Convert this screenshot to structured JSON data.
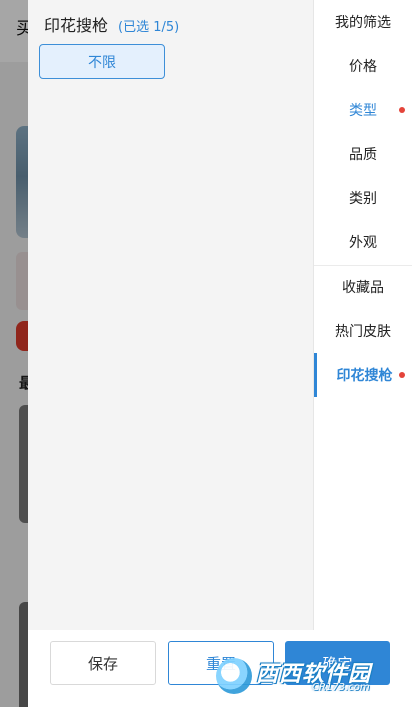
{
  "background": {
    "header_text": "买",
    "section_char": "最"
  },
  "filter": {
    "section_title": "印花搜枪",
    "selected_count": "(已选 1/5)",
    "option_unlimited": "不限"
  },
  "nav": {
    "items": [
      {
        "label": "我的筛选"
      },
      {
        "label": "价格"
      },
      {
        "label": "类型"
      },
      {
        "label": "品质"
      },
      {
        "label": "类别"
      },
      {
        "label": "外观"
      },
      {
        "label": "收藏品"
      },
      {
        "label": "热门皮肤"
      },
      {
        "label": "印花搜枪"
      }
    ],
    "active_index": 8,
    "dot_indices": [
      2,
      8
    ]
  },
  "footer": {
    "save_label": "保存",
    "reset_label": "重置",
    "confirm_label": "确定"
  },
  "watermark": {
    "main": "西西软件园",
    "sub": "CR173.com"
  },
  "colors": {
    "accent": "#2f86d6",
    "dot": "#e4443a",
    "chip_bg": "#e4f0fd"
  }
}
